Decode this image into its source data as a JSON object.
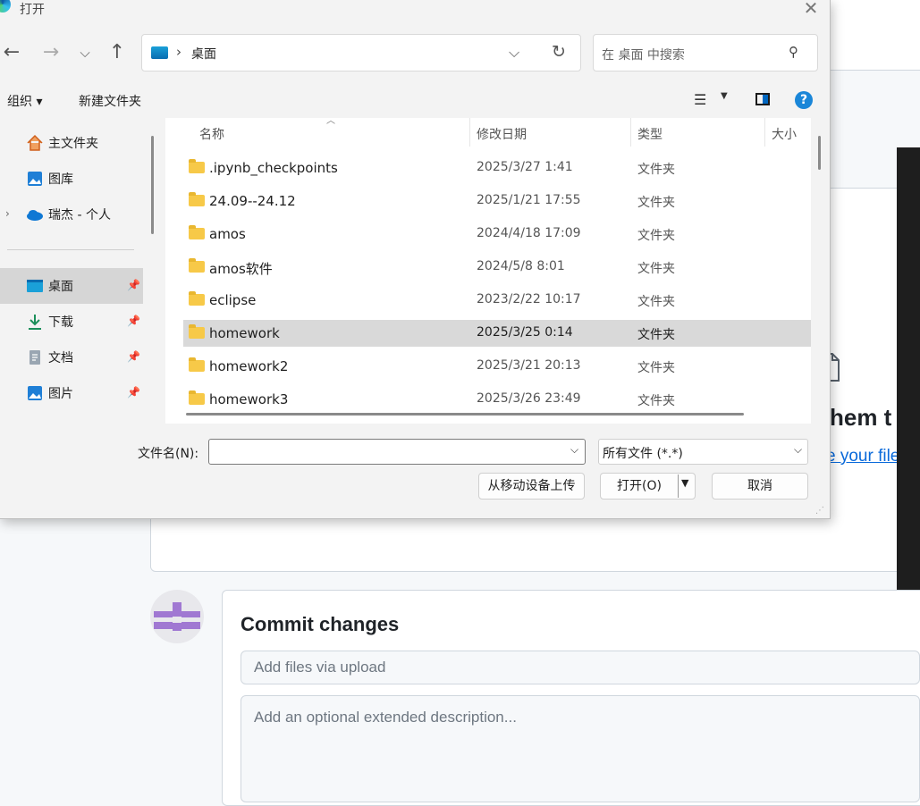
{
  "background": {
    "drag_text": "hem t",
    "link_text": "e your file",
    "commit": {
      "title": "Commit changes",
      "summary_placeholder": "Add files via upload",
      "description_placeholder": "Add an optional extended description..."
    }
  },
  "dialog": {
    "title": "打开",
    "address": {
      "location": "桌面"
    },
    "search_placeholder": "在 桌面 中搜索",
    "toolbar": {
      "organize": "组织 ▾",
      "new_folder": "新建文件夹",
      "help": "?"
    },
    "sidebar": [
      {
        "label": "主文件夹",
        "icon": "home-icon",
        "pinned": false
      },
      {
        "label": "图库",
        "icon": "gallery-icon",
        "pinned": false
      },
      {
        "label": "瑞杰 - 个人",
        "icon": "onedrive-cloud-icon",
        "pinned": false
      },
      {
        "label": "桌面",
        "icon": "desktop-icon",
        "pinned": true,
        "selected": true
      },
      {
        "label": "下载",
        "icon": "download-icon",
        "pinned": true
      },
      {
        "label": "文档",
        "icon": "document-icon",
        "pinned": true
      },
      {
        "label": "图片",
        "icon": "picture-icon",
        "pinned": true
      }
    ],
    "columns": {
      "name": "名称",
      "modified": "修改日期",
      "type": "类型",
      "size": "大小"
    },
    "files": [
      {
        "name": ".ipynb_checkpoints",
        "date": "2025/3/27 1:41",
        "type": "文件夹"
      },
      {
        "name": "24.09--24.12",
        "date": "2025/1/21 17:55",
        "type": "文件夹"
      },
      {
        "name": "amos",
        "date": "2024/4/18 17:09",
        "type": "文件夹"
      },
      {
        "name": "amos软件",
        "date": "2024/5/8 8:01",
        "type": "文件夹"
      },
      {
        "name": "eclipse",
        "date": "2023/2/22 10:17",
        "type": "文件夹"
      },
      {
        "name": "homework",
        "date": "2025/3/25 0:14",
        "type": "文件夹",
        "selected": true
      },
      {
        "name": "homework2",
        "date": "2025/3/21 20:13",
        "type": "文件夹"
      },
      {
        "name": "homework3",
        "date": "2025/3/26 23:49",
        "type": "文件夹"
      }
    ],
    "filename_label": "文件名(N):",
    "filename_value": "",
    "filetype": "所有文件 (*.*)",
    "buttons": {
      "upload": "从移动设备上传",
      "open": "打开(O)",
      "cancel": "取消"
    }
  }
}
